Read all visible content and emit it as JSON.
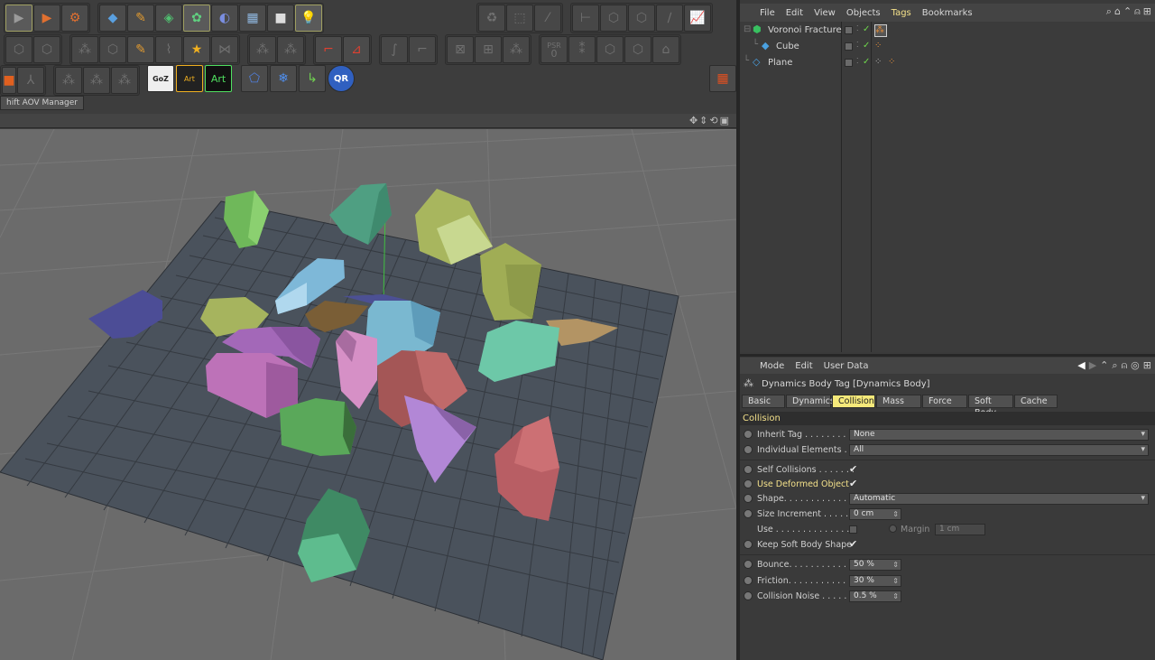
{
  "viewport": {
    "panel_tab": "hift AOV Manager"
  },
  "toolbar": {
    "row1": [
      "render-view-icon",
      "render-active-icon",
      "render-settings-icon",
      "cube-icon",
      "pen-icon",
      "subdivide-icon",
      "cloner-icon",
      "deformer-icon",
      "floor-icon",
      "camera-icon",
      "light-icon"
    ],
    "icons_text": {
      "goz": "GoZ",
      "art": "Art",
      "art2": "Art",
      "qr": "QR",
      "psr": "PSR",
      "psr_val": "0"
    }
  },
  "object_manager": {
    "menu": [
      "File",
      "Edit",
      "View",
      "Objects",
      "Tags",
      "Bookmarks"
    ],
    "active_menu": "Tags",
    "objects": [
      {
        "name": "Voronoi Fracture",
        "indent": 0
      },
      {
        "name": "Cube",
        "indent": 1
      },
      {
        "name": "Plane",
        "indent": 0
      }
    ]
  },
  "attribute_manager": {
    "menu": [
      "Mode",
      "Edit",
      "User Data"
    ],
    "title": "Dynamics Body Tag [Dynamics Body]",
    "tabs": [
      "Basic",
      "Dynamics",
      "Collision",
      "Mass",
      "Force",
      "Soft Body",
      "Cache"
    ],
    "selected_tab": "Collision",
    "section": "Collision",
    "props": {
      "inherit_tag": {
        "label": "Inherit Tag . . . . . . . . .",
        "value": "None"
      },
      "individual_elements": {
        "label": "Individual Elements . .",
        "value": "All"
      },
      "self_collisions": {
        "label": "Self Collisions . . . . . . .",
        "value": "✔"
      },
      "use_deformed_object": {
        "label": "Use Deformed Object",
        "value": "✔"
      },
      "shape": {
        "label": "Shape. . . . . . . . . . . . . .",
        "value": "Automatic"
      },
      "size_increment": {
        "label": "Size Increment . . . . . . .",
        "value": "0 cm"
      },
      "use": {
        "label": "Use . . . . . . . . . . . . . . ."
      },
      "margin": {
        "label": "Margin",
        "value": "1 cm"
      },
      "keep_soft_body_shape": {
        "label": "Keep Soft Body Shape",
        "value": "✔"
      },
      "bounce": {
        "label": "Bounce. . . . . . . . . . . . .",
        "value": "50 %"
      },
      "friction": {
        "label": "Friction. . . . . . . . . . . . .",
        "value": "30 %"
      },
      "collision_noise": {
        "label": "Collision Noise . . . . . . .",
        "value": "0.5 %"
      }
    }
  }
}
